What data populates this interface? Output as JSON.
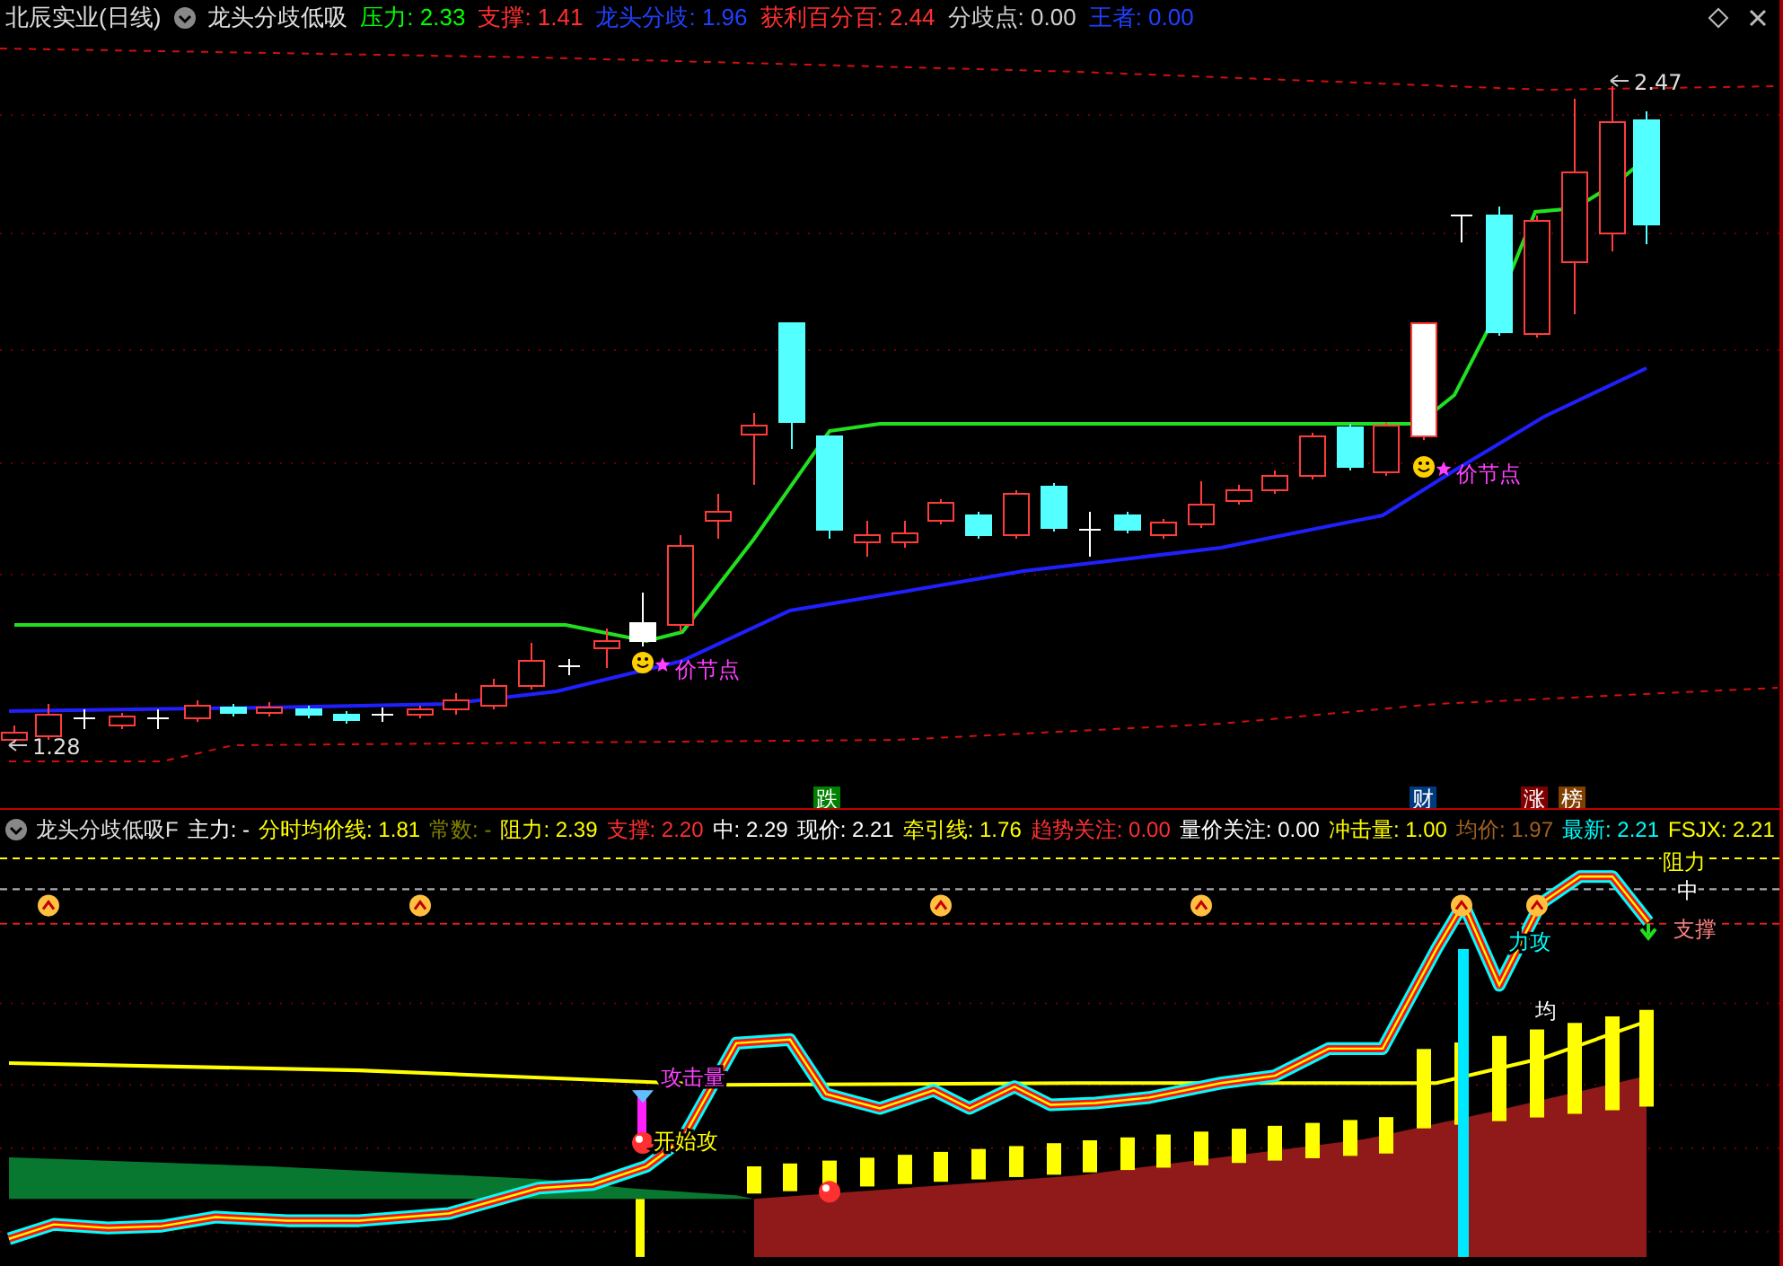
{
  "main_panel": {
    "security": "北辰实业(日线)",
    "indicator": "龙头分歧低吸",
    "legend": [
      {
        "text": "压力: 2.33",
        "color": "#00ff00"
      },
      {
        "text": "支撑: 1.41",
        "color": "#ff3030"
      },
      {
        "text": "龙头分歧: 1.96",
        "color": "#2040ff"
      },
      {
        "text": "获利百分百: 2.44",
        "color": "#ff3030"
      },
      {
        "text": "分歧点: 0.00",
        "color": "#d0d0d0"
      },
      {
        "text": "王者: 0.00",
        "color": "#2040ff"
      }
    ],
    "price_labels": [
      {
        "kind": "high",
        "text": "2.47"
      },
      {
        "kind": "low",
        "text": "1.28"
      }
    ],
    "annotations": [
      {
        "text": "价节点"
      },
      {
        "text": "价节点"
      }
    ],
    "signal_badges": [
      {
        "text": "跌",
        "color": "#008000"
      },
      {
        "text": "财",
        "color": "#003a80"
      },
      {
        "text": "涨",
        "color": "#800000"
      },
      {
        "text": "榜",
        "color": "#804000"
      }
    ]
  },
  "sub_panel": {
    "indicator": "龙头分歧低吸F",
    "legend": [
      {
        "text": "主力: -",
        "color": "#ffffff"
      },
      {
        "text": "分时均价线: 1.81",
        "color": "#ffff00"
      },
      {
        "text": "常数: -",
        "color": "#808000"
      },
      {
        "text": "阻力: 2.39",
        "color": "#ffff00"
      },
      {
        "text": "支撑: 2.20",
        "color": "#ff3030"
      },
      {
        "text": "中: 2.29",
        "color": "#ffffff"
      },
      {
        "text": "现价: 2.21",
        "color": "#ffffff"
      },
      {
        "text": "牵引线: 1.76",
        "color": "#ffff00"
      },
      {
        "text": "趋势关注: 0.00",
        "color": "#ff3030"
      },
      {
        "text": "量价关注: 0.00",
        "color": "#ffffff"
      },
      {
        "text": "冲击量: 1.00",
        "color": "#ffff00"
      },
      {
        "text": "均价: 1.97",
        "color": "#a06020"
      },
      {
        "text": "最新: 2.21",
        "color": "#00ffff"
      },
      {
        "text": "FSJX: 2.21",
        "color": "#ffff00"
      }
    ],
    "labels": [
      {
        "kind": "resistance",
        "text": "阻力"
      },
      {
        "kind": "middle",
        "text": "中"
      },
      {
        "kind": "support",
        "text": "支撑"
      },
      {
        "kind": "average",
        "text": "均"
      },
      {
        "kind": "attack_volume",
        "text": "攻击量"
      },
      {
        "kind": "attack_start",
        "text": "开始攻"
      },
      {
        "kind": "main_attack",
        "text": "力攻"
      }
    ]
  }
}
